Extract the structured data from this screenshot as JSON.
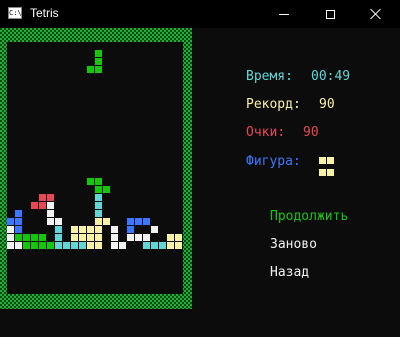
{
  "window": {
    "title": "Tetris",
    "icon": "console-icon",
    "icon_text": "C:\\"
  },
  "stats": {
    "time_label": "Время:",
    "time_value": "00:49",
    "record_label": "Рекорд:",
    "record_value": "90",
    "score_label": "Очки:",
    "score_value": "90",
    "figure_label": "Фигура:"
  },
  "menu": {
    "continue": "Продолжить",
    "restart": "Заново",
    "back": "Назад"
  },
  "colors": {
    "green": "#16c60c",
    "cyan": "#61d6d6",
    "blue": "#3b78ff",
    "red": "#e74856",
    "yellow": "#f9f1a5",
    "white": "#f2f2f2",
    "time": "#61d6d6",
    "record": "#f9f1a5",
    "score": "#e74856",
    "figure": "#3b78ff",
    "continue": "#16c60c",
    "menu": "#f2f2f2"
  },
  "next_piece": {
    "shape": "O",
    "color": "yellow",
    "cells": [
      [
        0,
        0
      ],
      [
        1,
        0
      ],
      [
        0,
        1
      ],
      [
        1,
        1
      ]
    ]
  },
  "falling_piece": {
    "shape": "J",
    "color": "green",
    "cells": [
      [
        11,
        1
      ],
      [
        11,
        2
      ],
      [
        11,
        3
      ],
      [
        10,
        3
      ]
    ]
  },
  "board": {
    "cols": 22,
    "rows": 32,
    "cells": [
      [
        10,
        17,
        "green"
      ],
      [
        11,
        17,
        "green"
      ],
      [
        11,
        18,
        "green"
      ],
      [
        12,
        18,
        "green"
      ],
      [
        4,
        19,
        "red"
      ],
      [
        5,
        19,
        "red"
      ],
      [
        11,
        19,
        "cyan"
      ],
      [
        3,
        20,
        "red"
      ],
      [
        4,
        20,
        "red"
      ],
      [
        5,
        20,
        "white"
      ],
      [
        11,
        20,
        "cyan"
      ],
      [
        1,
        21,
        "blue"
      ],
      [
        5,
        21,
        "white"
      ],
      [
        11,
        21,
        "cyan"
      ],
      [
        0,
        22,
        "blue"
      ],
      [
        1,
        22,
        "blue"
      ],
      [
        5,
        22,
        "white"
      ],
      [
        6,
        22,
        "white"
      ],
      [
        11,
        22,
        "yellow"
      ],
      [
        12,
        22,
        "yellow"
      ],
      [
        15,
        22,
        "blue"
      ],
      [
        16,
        22,
        "blue"
      ],
      [
        17,
        22,
        "blue"
      ],
      [
        0,
        23,
        "white"
      ],
      [
        1,
        23,
        "blue"
      ],
      [
        6,
        23,
        "cyan"
      ],
      [
        8,
        23,
        "yellow"
      ],
      [
        9,
        23,
        "yellow"
      ],
      [
        10,
        23,
        "yellow"
      ],
      [
        11,
        23,
        "yellow"
      ],
      [
        13,
        23,
        "white"
      ],
      [
        15,
        23,
        "blue"
      ],
      [
        18,
        23,
        "white"
      ],
      [
        0,
        24,
        "white"
      ],
      [
        1,
        24,
        "green"
      ],
      [
        2,
        24,
        "green"
      ],
      [
        3,
        24,
        "green"
      ],
      [
        4,
        24,
        "green"
      ],
      [
        6,
        24,
        "cyan"
      ],
      [
        8,
        24,
        "yellow"
      ],
      [
        9,
        24,
        "yellow"
      ],
      [
        10,
        24,
        "yellow"
      ],
      [
        11,
        24,
        "yellow"
      ],
      [
        13,
        24,
        "white"
      ],
      [
        15,
        24,
        "white"
      ],
      [
        16,
        24,
        "white"
      ],
      [
        17,
        24,
        "white"
      ],
      [
        20,
        24,
        "yellow"
      ],
      [
        21,
        24,
        "yellow"
      ],
      [
        0,
        25,
        "white"
      ],
      [
        1,
        25,
        "white"
      ],
      [
        2,
        25,
        "green"
      ],
      [
        3,
        25,
        "green"
      ],
      [
        4,
        25,
        "green"
      ],
      [
        5,
        25,
        "green"
      ],
      [
        6,
        25,
        "cyan"
      ],
      [
        7,
        25,
        "cyan"
      ],
      [
        8,
        25,
        "cyan"
      ],
      [
        9,
        25,
        "cyan"
      ],
      [
        10,
        25,
        "yellow"
      ],
      [
        11,
        25,
        "yellow"
      ],
      [
        13,
        25,
        "white"
      ],
      [
        14,
        25,
        "white"
      ],
      [
        17,
        25,
        "cyan"
      ],
      [
        18,
        25,
        "cyan"
      ],
      [
        19,
        25,
        "cyan"
      ],
      [
        20,
        25,
        "yellow"
      ],
      [
        21,
        25,
        "yellow"
      ]
    ]
  }
}
